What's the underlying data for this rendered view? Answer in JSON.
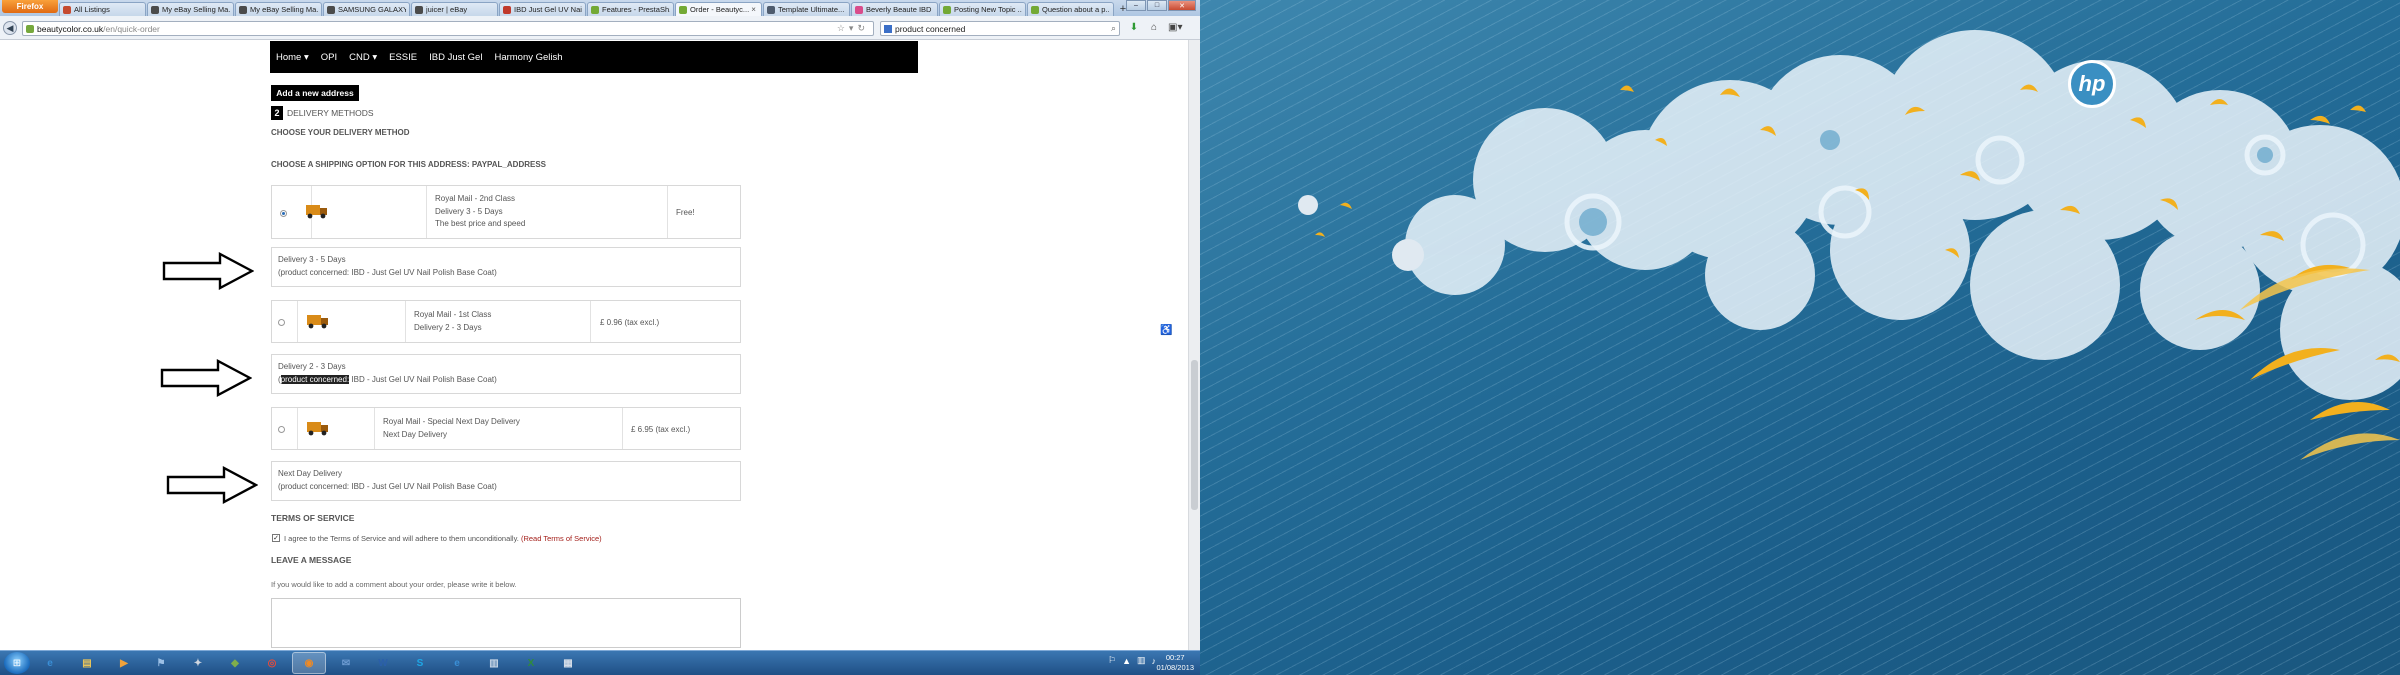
{
  "browser": {
    "firefox_label": "Firefox",
    "tabs": [
      {
        "label": "All Listings",
        "color": "#c54a2f"
      },
      {
        "label": "My eBay Selling Ma...",
        "color": "#4b4b4b"
      },
      {
        "label": "My eBay Selling Ma...",
        "color": "#4b4b4b"
      },
      {
        "label": "SAMSUNG GALAXY...",
        "color": "#4b4b4b"
      },
      {
        "label": "juicer | eBay",
        "color": "#4b4b4b"
      },
      {
        "label": "IBD Just Gel UV Nail...",
        "color": "#c0392b"
      },
      {
        "label": "Features - PrestaSh...",
        "color": "#73a935"
      },
      {
        "label": "Order - Beautyc...",
        "color": "#73a935",
        "active": true
      },
      {
        "label": "Template Ultimate...",
        "color": "#4e5b6d"
      },
      {
        "label": "Beverly Beaute IBD ...",
        "color": "#d94c8b"
      },
      {
        "label": "Posting New Topic ...",
        "color": "#73a935"
      },
      {
        "label": "Question about a p...",
        "color": "#73a935"
      }
    ],
    "new_tab": "+",
    "url_host": "beautycolor.co.uk",
    "url_path": "/en/quick-order",
    "search_value": "product concerned"
  },
  "site": {
    "menu": [
      "Home ▾",
      "OPI",
      "CND ▾",
      "ESSIE",
      "IBD Just Gel",
      "Harmony Gelish"
    ],
    "add_address": "Add a new address",
    "step_number": "2",
    "step_title": "Delivery methods",
    "choose_method": "CHOOSE YOUR DELIVERY METHOD",
    "choose_shipping": "CHOOSE A SHIPPING OPTION FOR THIS ADDRESS: PAYPAL_ADDRESS",
    "options": [
      {
        "name": "Royal Mail - 2nd Class",
        "line2": "Delivery 3 - 5 Days",
        "line3": "The best price and speed",
        "price": "Free!",
        "selected": true,
        "note_line1": "Delivery 3 - 5 Days",
        "note_hl": "",
        "note_line2": "(product concerned: IBD - Just Gel UV Nail Polish Base Coat)"
      },
      {
        "name": "Royal Mail - 1st Class",
        "line2": "Delivery 2 - 3 Days",
        "line3": "",
        "price": "£ 0.96 (tax excl.)",
        "selected": false,
        "note_line1": "Delivery 2 - 3 Days",
        "note_hl": "product concerned:",
        "note_line2": " IBD - Just Gel UV Nail Polish Base Coat)"
      },
      {
        "name": "Royal Mail - Special Next Day Delivery",
        "line2": "Next Day Delivery",
        "line3": "",
        "price": "£ 6.95 (tax excl.)",
        "selected": false,
        "note_line1": "Next Day Delivery",
        "note_hl": "",
        "note_line2": "(product concerned: IBD - Just Gel UV Nail Polish Base Coat)"
      }
    ],
    "tos_title": "TERMS OF SERVICE",
    "tos_text": "I agree to the Terms of Service and will adhere to them unconditionally.",
    "tos_link": "(Read Terms of Service)",
    "message_title": "LEAVE A MESSAGE",
    "message_hint": "If you would like to add a comment about your order, please write it below."
  },
  "taskbar": {
    "apps": [
      {
        "name": "ie",
        "glyph": "e",
        "color": "#3a8fd6"
      },
      {
        "name": "explorer",
        "glyph": "▤",
        "color": "#e9c55a"
      },
      {
        "name": "media-player",
        "glyph": "▶",
        "color": "#f0a23b"
      },
      {
        "name": "network-tool",
        "glyph": "⚑",
        "color": "#9cc0e6"
      },
      {
        "name": "settings-tool",
        "glyph": "✦",
        "color": "#d0d7e0"
      },
      {
        "name": "app-tile",
        "glyph": "◆",
        "color": "#7fae4b"
      },
      {
        "name": "chrome",
        "glyph": "◎",
        "color": "#e64a3b"
      },
      {
        "name": "firefox",
        "glyph": "◉",
        "color": "#f08a24",
        "active": true
      },
      {
        "name": "thunderbird",
        "glyph": "✉",
        "color": "#6d9bd1"
      },
      {
        "name": "word",
        "glyph": "W",
        "color": "#2b5faa"
      },
      {
        "name": "skype",
        "glyph": "S",
        "color": "#1ea7e6"
      },
      {
        "name": "ie-2",
        "glyph": "e",
        "color": "#3a8fd6"
      },
      {
        "name": "explorer-2",
        "glyph": "▥",
        "color": "#c8d6e6"
      },
      {
        "name": "excel",
        "glyph": "X",
        "color": "#2f8a3e"
      },
      {
        "name": "notepad",
        "glyph": "▦",
        "color": "#d5dde8"
      }
    ],
    "time": "00:27",
    "date": "01/08/2013"
  },
  "wallpaper": {
    "logo_text": "hp"
  }
}
